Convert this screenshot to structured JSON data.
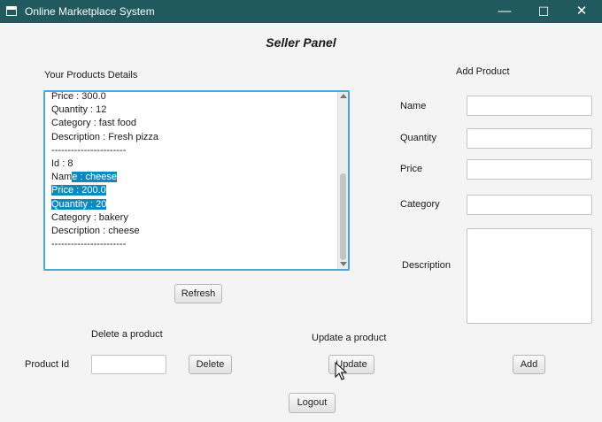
{
  "window": {
    "title": "Online Marketplace System",
    "controls": {
      "minimize": "—",
      "maximize": "☐",
      "close": "✕"
    }
  },
  "heading": "Seller Panel",
  "products": {
    "label": "Your Products Details",
    "lines": [
      "Price : 300.0",
      "Quantity : 12",
      "Category : fast food",
      "Description : Fresh pizza",
      "-----------------------",
      "Id : 8",
      "Name : cheese",
      "Price : 200.0",
      "Quantity : 20",
      "Category : bakery",
      "Description : cheese",
      "-----------------------"
    ],
    "selected_text": "e : cheese\nPrice : 200.0\nQuantity : 20",
    "refresh_label": "Refresh"
  },
  "add_product": {
    "heading": "Add Product",
    "name_label": "Name",
    "quantity_label": "Quantity",
    "price_label": "Price",
    "category_label": "Category",
    "description_label": "Description",
    "add_label": "Add",
    "name_value": "",
    "quantity_value": "",
    "price_value": "",
    "category_value": "",
    "description_value": ""
  },
  "delete_product": {
    "heading": "Delete a product",
    "product_id_label": "Product Id",
    "product_id_value": "",
    "delete_label": "Delete"
  },
  "update_product": {
    "heading": "Update a product",
    "update_label": "Update"
  },
  "logout_label": "Logout",
  "colors": {
    "titlebar": "#205a5e",
    "focus_border": "#49a6d6",
    "selection": "#0e89c0"
  }
}
